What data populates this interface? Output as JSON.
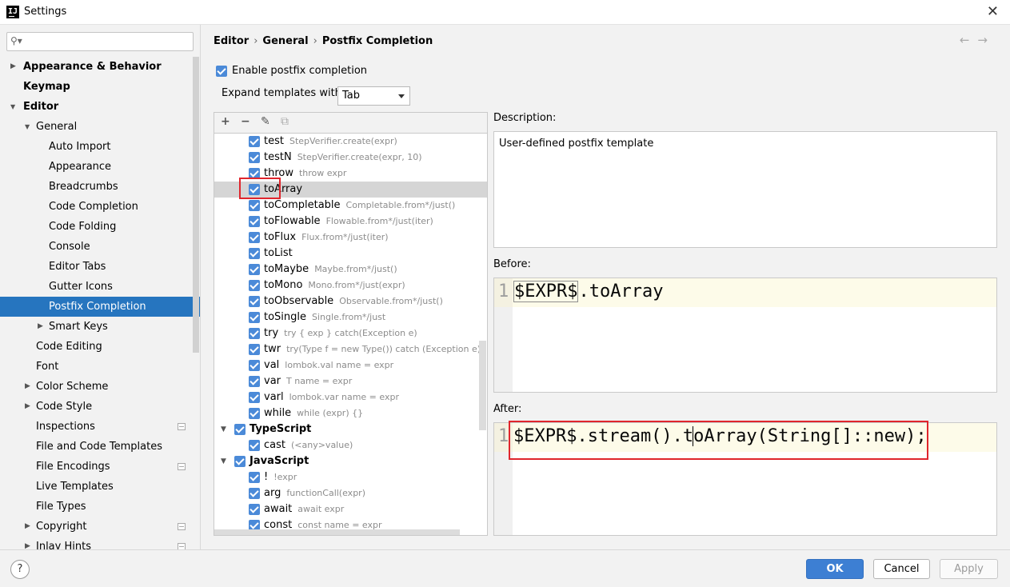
{
  "window": {
    "title": "Settings",
    "icon_text": "IJ"
  },
  "sidebar": {
    "search_placeholder": "",
    "items": [
      {
        "label": "Appearance & Behavior",
        "level": 0,
        "bold": true,
        "arrow": "right"
      },
      {
        "label": "Keymap",
        "level": 0,
        "bold": true,
        "arrow": ""
      },
      {
        "label": "Editor",
        "level": 0,
        "bold": true,
        "arrow": "down"
      },
      {
        "label": "General",
        "level": 1,
        "bold": false,
        "arrow": "down"
      },
      {
        "label": "Auto Import",
        "level": 2,
        "bold": false,
        "arrow": ""
      },
      {
        "label": "Appearance",
        "level": 2,
        "bold": false,
        "arrow": ""
      },
      {
        "label": "Breadcrumbs",
        "level": 2,
        "bold": false,
        "arrow": ""
      },
      {
        "label": "Code Completion",
        "level": 2,
        "bold": false,
        "arrow": ""
      },
      {
        "label": "Code Folding",
        "level": 2,
        "bold": false,
        "arrow": ""
      },
      {
        "label": "Console",
        "level": 2,
        "bold": false,
        "arrow": ""
      },
      {
        "label": "Editor Tabs",
        "level": 2,
        "bold": false,
        "arrow": ""
      },
      {
        "label": "Gutter Icons",
        "level": 2,
        "bold": false,
        "arrow": ""
      },
      {
        "label": "Postfix Completion",
        "level": 2,
        "bold": false,
        "arrow": "",
        "selected": true
      },
      {
        "label": "Smart Keys",
        "level": 2,
        "bold": false,
        "arrow": "right"
      },
      {
        "label": "Code Editing",
        "level": 1,
        "bold": false,
        "arrow": ""
      },
      {
        "label": "Font",
        "level": 1,
        "bold": false,
        "arrow": ""
      },
      {
        "label": "Color Scheme",
        "level": 1,
        "bold": false,
        "arrow": "right"
      },
      {
        "label": "Code Style",
        "level": 1,
        "bold": false,
        "arrow": "right"
      },
      {
        "label": "Inspections",
        "level": 1,
        "bold": false,
        "arrow": "",
        "badge": true
      },
      {
        "label": "File and Code Templates",
        "level": 1,
        "bold": false,
        "arrow": ""
      },
      {
        "label": "File Encodings",
        "level": 1,
        "bold": false,
        "arrow": "",
        "badge": true
      },
      {
        "label": "Live Templates",
        "level": 1,
        "bold": false,
        "arrow": ""
      },
      {
        "label": "File Types",
        "level": 1,
        "bold": false,
        "arrow": ""
      },
      {
        "label": "Copyright",
        "level": 1,
        "bold": false,
        "arrow": "right",
        "badge": true
      },
      {
        "label": "Inlay Hints",
        "level": 1,
        "bold": false,
        "arrow": "right",
        "badge": true
      }
    ]
  },
  "breadcrumb": {
    "parts": [
      "Editor",
      "General",
      "Postfix Completion"
    ],
    "separator": "›"
  },
  "nav": {
    "back": "←",
    "forward": "→"
  },
  "options": {
    "enable_label": "Enable postfix completion",
    "enable_checked": true,
    "expand_label": "Expand templates with",
    "expand_value": "Tab"
  },
  "toolbar": {
    "add": "+",
    "remove": "−",
    "edit": "✎",
    "copy": "⧉"
  },
  "templates": [
    {
      "key": "test",
      "example": "StepVerifier.create(expr)",
      "indent": 2
    },
    {
      "key": "testN",
      "example": "StepVerifier.create(expr, 10)",
      "indent": 2
    },
    {
      "key": "throw",
      "example": "throw expr",
      "indent": 2
    },
    {
      "key": "toArray",
      "example": "",
      "indent": 2,
      "selected": true
    },
    {
      "key": "toCompletable",
      "example": "Completable.from*/just()",
      "indent": 2
    },
    {
      "key": "toFlowable",
      "example": "Flowable.from*/just(iter)",
      "indent": 2
    },
    {
      "key": "toFlux",
      "example": "Flux.from*/just(iter)",
      "indent": 2
    },
    {
      "key": "toList",
      "example": "",
      "indent": 2
    },
    {
      "key": "toMaybe",
      "example": "Maybe.from*/just()",
      "indent": 2
    },
    {
      "key": "toMono",
      "example": "Mono.from*/just(expr)",
      "indent": 2
    },
    {
      "key": "toObservable",
      "example": "Observable.from*/just()",
      "indent": 2
    },
    {
      "key": "toSingle",
      "example": "Single.from*/just",
      "indent": 2
    },
    {
      "key": "try",
      "example": "try { exp } catch(Exception e)",
      "indent": 2
    },
    {
      "key": "twr",
      "example": "try(Type f = new Type()) catch (Exception e)",
      "indent": 2
    },
    {
      "key": "val",
      "example": "lombok.val name = expr",
      "indent": 2
    },
    {
      "key": "var",
      "example": "T name = expr",
      "indent": 2
    },
    {
      "key": "varl",
      "example": "lombok.var name = expr",
      "indent": 2
    },
    {
      "key": "while",
      "example": "while (expr) {}",
      "indent": 2
    },
    {
      "key": "TypeScript",
      "example": "",
      "indent": 1,
      "group": true
    },
    {
      "key": "cast",
      "example": "(<any>value)",
      "indent": 2
    },
    {
      "key": "JavaScript",
      "example": "",
      "indent": 1,
      "group": true
    },
    {
      "key": "!",
      "example": "!expr",
      "indent": 2
    },
    {
      "key": "arg",
      "example": "functionCall(expr)",
      "indent": 2
    },
    {
      "key": "await",
      "example": "await expr",
      "indent": 2
    },
    {
      "key": "const",
      "example": "const name = expr",
      "indent": 2
    }
  ],
  "description": {
    "label": "Description:",
    "text": "User-defined postfix template"
  },
  "before": {
    "label": "Before:",
    "line_number": "1",
    "var": "$EXPR$",
    "rest": ".toArray"
  },
  "after": {
    "label": "After:",
    "line_number": "1",
    "code_a": "$EXPR$.stream().t",
    "code_b": "oArray(String[]::new);"
  },
  "buttons": {
    "help": "?",
    "ok": "OK",
    "cancel": "Cancel",
    "apply": "Apply"
  },
  "colors": {
    "accent": "#2675bf",
    "checkbox": "#4b8ad8",
    "highlight_box": "#e0262d"
  }
}
